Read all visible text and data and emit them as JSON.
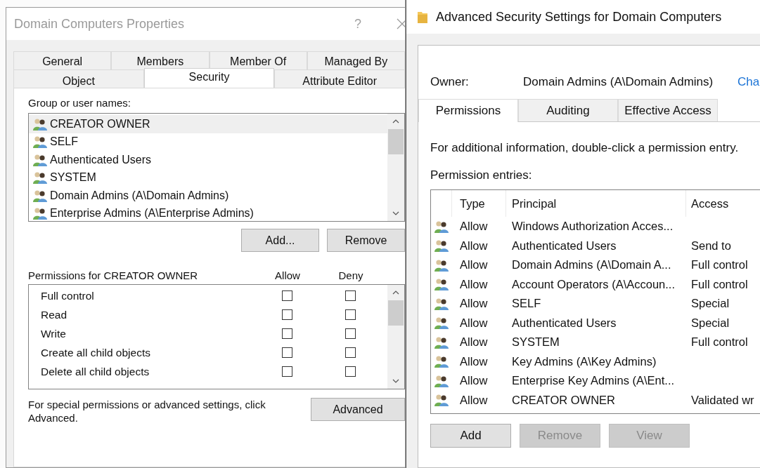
{
  "properties_dialog": {
    "title": "Domain Computers Properties",
    "help": "?",
    "tab_rows": [
      [
        {
          "label": "General",
          "selected": false
        },
        {
          "label": "Members",
          "selected": false
        },
        {
          "label": "Member Of",
          "selected": false
        },
        {
          "label": "Managed By",
          "selected": false
        }
      ],
      [
        {
          "label": "Object",
          "selected": false
        },
        {
          "label": "Security",
          "selected": true
        },
        {
          "label": "Attribute Editor",
          "selected": false
        }
      ]
    ],
    "group_label": "Group or user names:",
    "groups": [
      {
        "name": "CREATOR OWNER",
        "selected": true
      },
      {
        "name": "SELF",
        "selected": false
      },
      {
        "name": "Authenticated Users",
        "selected": false
      },
      {
        "name": "SYSTEM",
        "selected": false
      },
      {
        "name": "Domain Admins (A\\Domain Admins)",
        "selected": false
      },
      {
        "name": "Enterprise Admins (A\\Enterprise Admins)",
        "selected": false
      }
    ],
    "group_buttons": [
      "Add...",
      "Remove"
    ],
    "permissions_label": "Permissions for CREATOR OWNER",
    "allow_label": "Allow",
    "deny_label": "Deny",
    "permissions": [
      {
        "name": "Full control",
        "allow": false,
        "deny": false
      },
      {
        "name": "Read",
        "allow": false,
        "deny": false
      },
      {
        "name": "Write",
        "allow": false,
        "deny": false
      },
      {
        "name": "Create all child objects",
        "allow": false,
        "deny": false
      },
      {
        "name": "Delete all child objects",
        "allow": false,
        "deny": false
      }
    ],
    "advanced_note": "For special permissions or advanced settings, click Advanced.",
    "advanced_button": "Advanced"
  },
  "advanced_window": {
    "title": "Advanced Security Settings for Domain Computers",
    "owner_label": "Owner:",
    "owner": "Domain Admins (A\\Domain Admins)",
    "owner_link": "Cha",
    "tabs": [
      {
        "label": "Permissions",
        "selected": true
      },
      {
        "label": "Auditing",
        "selected": false
      },
      {
        "label": "Effective Access",
        "selected": false
      }
    ],
    "info": "For additional information, double-click a permission entry.",
    "entries_label": "Permission entries:",
    "columns": [
      "Type",
      "Principal",
      "Access"
    ],
    "entries": [
      {
        "type": "Allow",
        "principal": "Windows Authorization Acces..."
      },
      {
        "type": "Allow",
        "principal": "Authenticated Users",
        "access": "Send to"
      },
      {
        "type": "Allow",
        "principal": "Domain Admins (A\\Domain A...",
        "access": "Full control"
      },
      {
        "type": "Allow",
        "principal": "Account Operators (A\\Accoun...",
        "access": "Full control"
      },
      {
        "type": "Allow",
        "principal": "SELF",
        "access": "Special"
      },
      {
        "type": "Allow",
        "principal": "Authenticated Users",
        "access": "Special"
      },
      {
        "type": "Allow",
        "principal": "SYSTEM",
        "access": "Full control"
      },
      {
        "type": "Allow",
        "principal": "Key Admins (A\\Key Admins)"
      },
      {
        "type": "Allow",
        "principal": "Enterprise Key Admins (A\\Ent..."
      },
      {
        "type": "Allow",
        "principal": "CREATOR OWNER",
        "access": "Validated wr"
      }
    ],
    "buttons": [
      {
        "label": "Add",
        "disabled": false
      },
      {
        "label": "Remove",
        "disabled": true
      },
      {
        "label": "View",
        "disabled": true
      }
    ]
  }
}
